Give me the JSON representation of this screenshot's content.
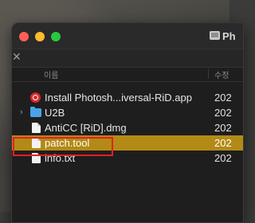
{
  "window": {
    "title": "Ph"
  },
  "toolbar": {
    "close_glyph": "✕"
  },
  "columns": {
    "name": "이름",
    "date": "수정"
  },
  "files": [
    {
      "name": "Install Photosh...iversal-RiD.app",
      "date": "202",
      "icon": "app-icon",
      "expandable": false,
      "selected": false
    },
    {
      "name": "U2B",
      "date": "202",
      "icon": "folder-icon",
      "expandable": true,
      "selected": false
    },
    {
      "name": "AntiCC [RiD].dmg",
      "date": "202",
      "icon": "document-icon",
      "expandable": false,
      "selected": false
    },
    {
      "name": "patch.tool",
      "date": "202",
      "icon": "document-icon",
      "expandable": false,
      "selected": true
    },
    {
      "name": "info.txt",
      "date": "202",
      "icon": "document-icon",
      "expandable": false,
      "selected": false
    }
  ],
  "colors": {
    "selection": "#b38a16",
    "highlight_box": "#e41f26",
    "folder": "#4aa3e8",
    "app_icon": "#d8272c"
  },
  "chevron_glyph": "›"
}
